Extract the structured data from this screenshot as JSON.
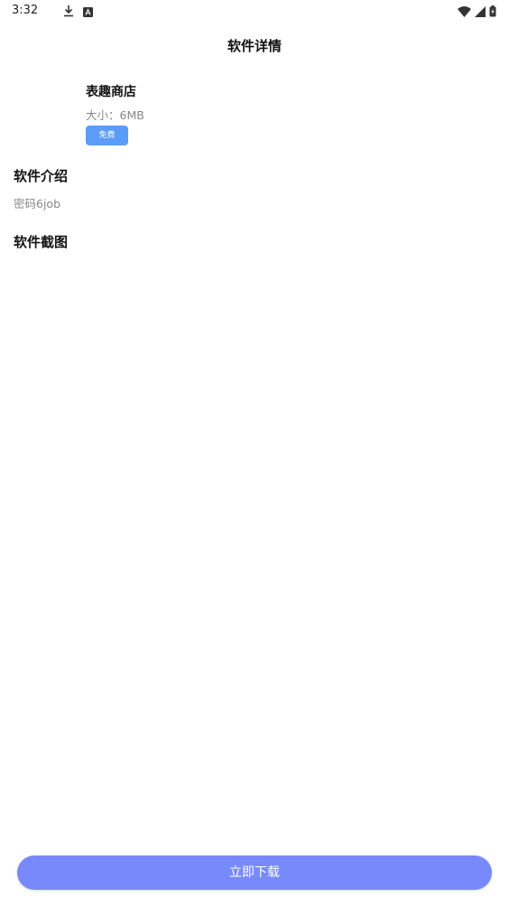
{
  "status_bar": {
    "time": "3:32",
    "left_icons": [
      "download-icon",
      "a-badge-icon"
    ],
    "right_icons": [
      "wifi-icon",
      "signal-icon",
      "battery-icon"
    ]
  },
  "header": {
    "title": "软件详情"
  },
  "app": {
    "name": "表趣商店",
    "size": "大小：6MB",
    "price_label": "免费"
  },
  "intro": {
    "heading": "软件介绍",
    "text": "密码6job"
  },
  "screenshots": {
    "heading": "软件截图"
  },
  "footer": {
    "download_label": "立即下载"
  },
  "colors": {
    "badge": "#5b9cf6",
    "download_button": "#7889fb",
    "muted_text": "#888888"
  }
}
